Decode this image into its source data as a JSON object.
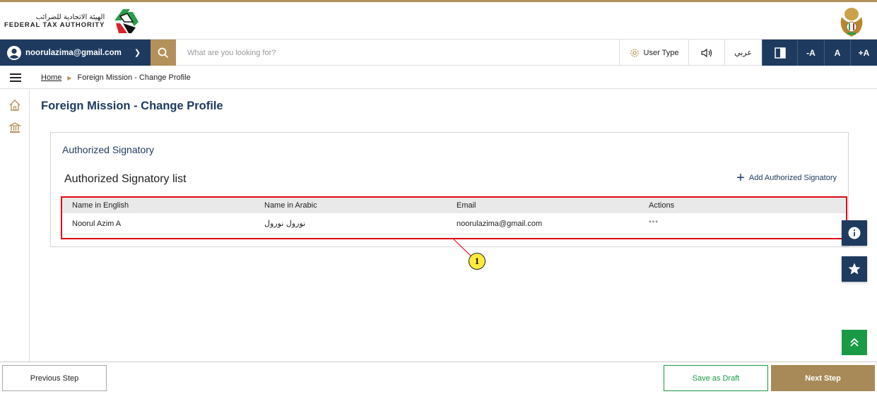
{
  "header": {
    "logo_arabic": "الهيئة الاتحادية للضرائب",
    "logo_english": "FEDERAL TAX AUTHORITY",
    "emblem_icon": "uae-emblem-icon"
  },
  "toolbar": {
    "user_email": "noorulazima@gmail.com",
    "search_placeholder": "What are you looking for?",
    "user_type_label": "User Type",
    "language_label": "عربي",
    "font_decrease": "-A",
    "font_normal": "A",
    "font_increase": "+A"
  },
  "breadcrumb": {
    "home": "Home",
    "current": "Foreign Mission - Change Profile"
  },
  "page": {
    "title": "Foreign Mission - Change Profile"
  },
  "card": {
    "title": "Authorized Signatory",
    "list_title": "Authorized Signatory list",
    "add_button": "Add Authorized Signatory",
    "columns": [
      "Name in English",
      "Name in Arabic",
      "Email",
      "Actions"
    ],
    "rows": [
      {
        "name_en": "Noorul Azim A",
        "name_ar": "نورول نورول",
        "email": "noorulazima@gmail.com",
        "actions": "°°°"
      }
    ]
  },
  "annotation": {
    "callout_number": "1"
  },
  "footer": {
    "previous": "Previous Step",
    "save_draft": "Save as Draft",
    "next": "Next Step"
  },
  "colors": {
    "navy": "#1e3a5f",
    "gold": "#b3915a",
    "green": "#1a9a46",
    "highlight_red": "#e30613",
    "callout_yellow": "#ffeb3b"
  }
}
